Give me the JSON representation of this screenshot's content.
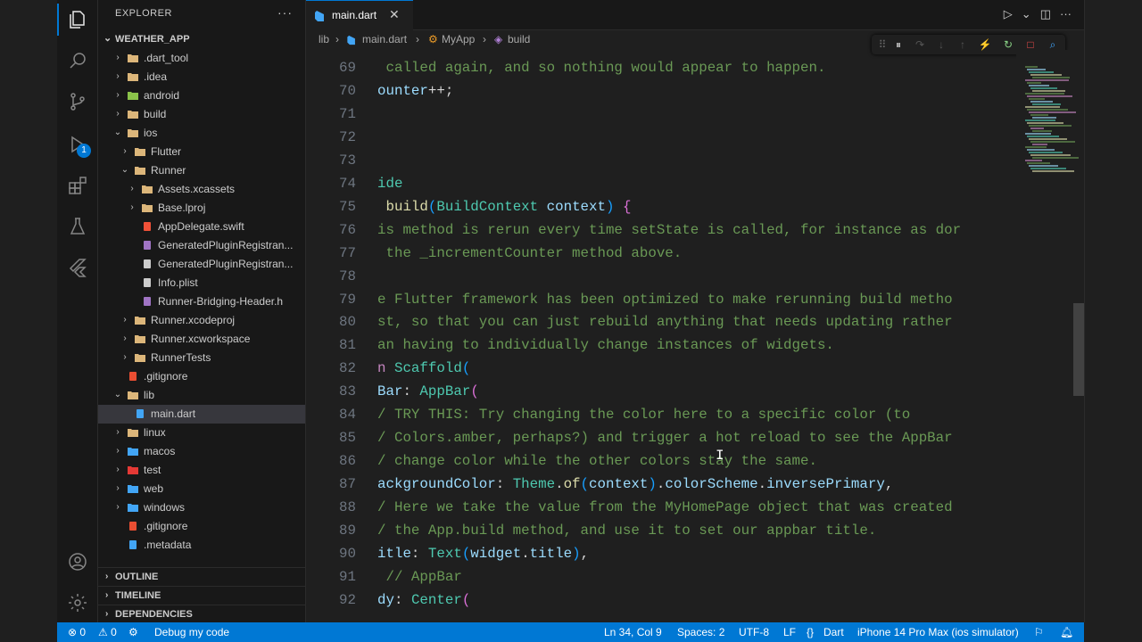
{
  "explorer": {
    "title": "EXPLORER",
    "more": "···",
    "root": "WEATHER_APP",
    "items": [
      {
        "label": ".dart_tool",
        "chev": "›",
        "icon": "folder",
        "color": "#dcb67a"
      },
      {
        "label": ".idea",
        "chev": "›",
        "icon": "folder",
        "color": "#dcb67a"
      },
      {
        "label": "android",
        "chev": "›",
        "icon": "android-folder",
        "color": "#8bc34a"
      },
      {
        "label": "build",
        "chev": "›",
        "icon": "folder",
        "color": "#dcb67a"
      },
      {
        "label": "ios",
        "chev": "⌄",
        "icon": "folder-open",
        "color": "#dcb67a"
      },
      {
        "label": "Flutter",
        "chev": "›",
        "icon": "folder",
        "color": "#dcb67a"
      },
      {
        "label": "Runner",
        "chev": "⌄",
        "icon": "folder-open",
        "color": "#dcb67a"
      },
      {
        "label": "Assets.xcassets",
        "chev": "›",
        "icon": "folder",
        "color": "#dcb67a"
      },
      {
        "label": "Base.lproj",
        "chev": "›",
        "icon": "folder",
        "color": "#dcb67a"
      },
      {
        "label": "AppDelegate.swift",
        "chev": "",
        "icon": "swift-file",
        "color": "#f05138"
      },
      {
        "label": "GeneratedPluginRegistran...",
        "chev": "",
        "icon": "h-file",
        "color": "#a074c4"
      },
      {
        "label": "GeneratedPluginRegistran...",
        "chev": "",
        "icon": "c-file",
        "color": "#cccccc"
      },
      {
        "label": "Info.plist",
        "chev": "",
        "icon": "gear-file",
        "color": "#cccccc"
      },
      {
        "label": "Runner-Bridging-Header.h",
        "chev": "",
        "icon": "h-file",
        "color": "#a074c4"
      },
      {
        "label": "Runner.xcodeproj",
        "chev": "›",
        "icon": "folder",
        "color": "#dcb67a"
      },
      {
        "label": "Runner.xcworkspace",
        "chev": "›",
        "icon": "folder",
        "color": "#dcb67a"
      },
      {
        "label": "RunnerTests",
        "chev": "›",
        "icon": "folder",
        "color": "#dcb67a"
      },
      {
        "label": ".gitignore",
        "chev": "",
        "icon": "git-file",
        "color": "#e94e32"
      },
      {
        "label": "lib",
        "chev": "⌄",
        "icon": "folder-open",
        "color": "#dcb67a"
      },
      {
        "label": "main.dart",
        "chev": "",
        "icon": "dart-file",
        "color": "#42a5f5"
      },
      {
        "label": "linux",
        "chev": "›",
        "icon": "linux-folder",
        "color": "#dcb67a"
      },
      {
        "label": "macos",
        "chev": "›",
        "icon": "macos-folder",
        "color": "#42a5f5"
      },
      {
        "label": "test",
        "chev": "›",
        "icon": "test-folder",
        "color": "#e53935"
      },
      {
        "label": "web",
        "chev": "›",
        "icon": "web-folder",
        "color": "#42a5f5"
      },
      {
        "label": "windows",
        "chev": "›",
        "icon": "windows-folder",
        "color": "#42a5f5"
      },
      {
        "label": ".gitignore",
        "chev": "",
        "icon": "git-file",
        "color": "#e94e32"
      },
      {
        "label": ".metadata",
        "chev": "",
        "icon": "metadata-file",
        "color": "#42a5f5"
      }
    ],
    "sections": [
      "OUTLINE",
      "TIMELINE",
      "DEPENDENCIES"
    ]
  },
  "tab": {
    "label": "main.dart",
    "close": "✕"
  },
  "breadcrumb": {
    "p1": "lib",
    "sep": "›",
    "p2": "main.dart",
    "p3": "MyApp",
    "p4": "build"
  },
  "code_lines": [
    {
      "n": "69",
      "segs": [
        [
          "c-cm",
          " called again, and so nothing would appear to happen."
        ]
      ]
    },
    {
      "n": "70",
      "segs": [
        [
          "c-va",
          "ounter"
        ],
        [
          "c-pu",
          "++;"
        ]
      ]
    },
    {
      "n": "71",
      "segs": []
    },
    {
      "n": "72",
      "segs": []
    },
    {
      "n": "73",
      "segs": []
    },
    {
      "n": "74",
      "segs": [
        [
          "c-ty",
          "ide"
        ]
      ]
    },
    {
      "n": "75",
      "segs": [
        [
          "c-pu",
          " "
        ],
        [
          "c-fn",
          "build"
        ],
        [
          "c-br2",
          "("
        ],
        [
          "c-ty",
          "BuildContext"
        ],
        [
          "c-pu",
          " "
        ],
        [
          "c-va",
          "context"
        ],
        [
          "c-br2",
          ")"
        ],
        [
          "c-pu",
          " "
        ],
        [
          "c-br1",
          "{"
        ]
      ]
    },
    {
      "n": "76",
      "segs": [
        [
          "c-cm",
          "is method is rerun every time setState is called, for instance as dor"
        ]
      ]
    },
    {
      "n": "77",
      "segs": [
        [
          "c-cm",
          " the _incrementCounter method above."
        ]
      ]
    },
    {
      "n": "78",
      "segs": []
    },
    {
      "n": "79",
      "segs": [
        [
          "c-cm",
          "e Flutter framework has been optimized to make rerunning build metho"
        ]
      ]
    },
    {
      "n": "80",
      "segs": [
        [
          "c-cm",
          "st, so that you can just rebuild anything that needs updating rather"
        ]
      ]
    },
    {
      "n": "81",
      "segs": [
        [
          "c-cm",
          "an having to individually change instances of widgets."
        ]
      ]
    },
    {
      "n": "82",
      "segs": [
        [
          "c-kw",
          "n"
        ],
        [
          "c-pu",
          " "
        ],
        [
          "c-ty",
          "Scaffold"
        ],
        [
          "c-br2",
          "("
        ]
      ]
    },
    {
      "n": "83",
      "segs": [
        [
          "c-va",
          "Bar"
        ],
        [
          "c-pu",
          ": "
        ],
        [
          "c-ty",
          "AppBar"
        ],
        [
          "c-br1",
          "("
        ]
      ]
    },
    {
      "n": "84",
      "segs": [
        [
          "c-cm",
          "/ TRY THIS: Try changing the color here to a specific color (to"
        ]
      ]
    },
    {
      "n": "85",
      "segs": [
        [
          "c-cm",
          "/ Colors.amber, perhaps?) and trigger a hot reload to see the AppBar"
        ]
      ]
    },
    {
      "n": "86",
      "segs": [
        [
          "c-cm",
          "/ change color while the other colors stay the same."
        ]
      ]
    },
    {
      "n": "87",
      "segs": [
        [
          "c-va",
          "ackgroundColor"
        ],
        [
          "c-pu",
          ": "
        ],
        [
          "c-ty",
          "Theme"
        ],
        [
          "c-pu",
          "."
        ],
        [
          "c-fn",
          "of"
        ],
        [
          "c-br2",
          "("
        ],
        [
          "c-va",
          "context"
        ],
        [
          "c-br2",
          ")"
        ],
        [
          "c-pu",
          "."
        ],
        [
          "c-va",
          "colorScheme"
        ],
        [
          "c-pu",
          "."
        ],
        [
          "c-va",
          "inversePrimary"
        ],
        [
          "c-pu",
          ","
        ]
      ]
    },
    {
      "n": "88",
      "segs": [
        [
          "c-cm",
          "/ Here we take the value from the MyHomePage object that was created"
        ]
      ]
    },
    {
      "n": "89",
      "segs": [
        [
          "c-cm",
          "/ the App.build method, and use it to set our appbar title."
        ]
      ]
    },
    {
      "n": "90",
      "segs": [
        [
          "c-va",
          "itle"
        ],
        [
          "c-pu",
          ": "
        ],
        [
          "c-ty",
          "Text"
        ],
        [
          "c-br2",
          "("
        ],
        [
          "c-va",
          "widget"
        ],
        [
          "c-pu",
          "."
        ],
        [
          "c-va",
          "title"
        ],
        [
          "c-br2",
          ")"
        ],
        [
          "c-pu",
          ","
        ]
      ]
    },
    {
      "n": "91",
      "segs": [
        [
          "c-cm",
          " // AppBar"
        ]
      ]
    },
    {
      "n": "92",
      "segs": [
        [
          "c-va",
          "dy"
        ],
        [
          "c-pu",
          ": "
        ],
        [
          "c-ty",
          "Center"
        ],
        [
          "c-br1",
          "("
        ]
      ]
    }
  ],
  "statusbar": {
    "errors": "⊗ 0",
    "warnings": "⚠ 0",
    "debug": "Debug my code",
    "position": "Ln 34, Col 9",
    "spaces": "Spaces: 2",
    "encoding": "UTF-8",
    "eol": "LF",
    "language": "Dart",
    "device": "iPhone 14 Pro Max (ios simulator)"
  },
  "colors": {
    "accent": "#0078d4",
    "statusbar": "#0078d4",
    "selection": "#37373d"
  }
}
